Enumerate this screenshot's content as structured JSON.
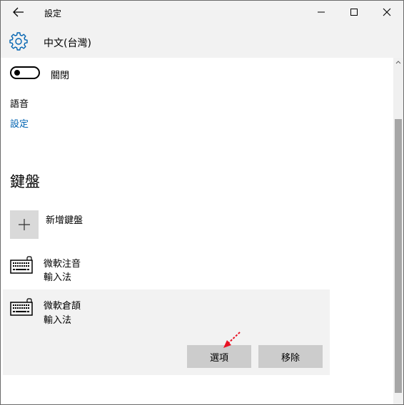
{
  "window": {
    "title": "設定"
  },
  "header": {
    "title": "中文(台灣)"
  },
  "toggle": {
    "label": "關閉",
    "state": "off"
  },
  "speech": {
    "heading": "語音",
    "settings_link": "設定"
  },
  "keyboards": {
    "heading": "鍵盤",
    "add_label": "新增鍵盤",
    "items": [
      {
        "name": "微軟注音",
        "sub": "輸入法"
      },
      {
        "name": "微軟倉頡",
        "sub": "輸入法"
      }
    ],
    "options_label": "選項",
    "remove_label": "移除"
  },
  "colors": {
    "accent": "#0063b1",
    "titlebar_bg": "#f2f2f2",
    "selected_item_bg": "#f2f2f2",
    "button_bg": "#cccccc",
    "annotation_arrow": "#e81123"
  }
}
